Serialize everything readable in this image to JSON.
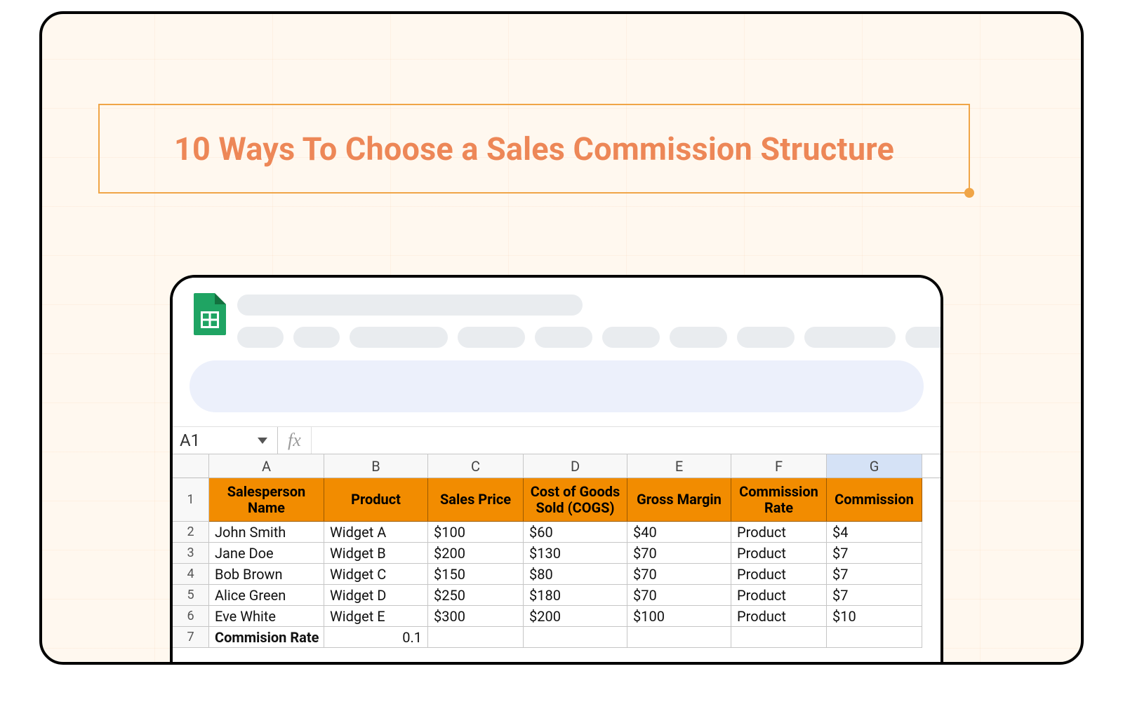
{
  "title": "10 Ways To Choose a Sales Commission Structure",
  "sheet": {
    "name_box": "A1",
    "fx_label": "fx",
    "columns": [
      "A",
      "B",
      "C",
      "D",
      "E",
      "F",
      "G"
    ],
    "selected_col": "G",
    "header_row_num": "1",
    "headers": {
      "A": "Salesperson Name",
      "B": "Product",
      "C": "Sales Price",
      "D": "Cost of Goods Sold (COGS)",
      "E": "Gross Margin",
      "F": "Commission Rate",
      "G": "Commission"
    },
    "rows": [
      {
        "num": "2",
        "A": "John Smith",
        "B": "Widget A",
        "C": "$100",
        "D": "$60",
        "E": "$40",
        "F": "Product",
        "G": "$4"
      },
      {
        "num": "3",
        "A": "Jane Doe",
        "B": "Widget B",
        "C": "$200",
        "D": "$130",
        "E": "$70",
        "F": "Product",
        "G": "$7"
      },
      {
        "num": "4",
        "A": "Bob Brown",
        "B": "Widget C",
        "C": "$150",
        "D": "$80",
        "E": "$70",
        "F": "Product",
        "G": "$7"
      },
      {
        "num": "5",
        "A": "Alice Green",
        "B": "Widget D",
        "C": "$250",
        "D": "$180",
        "E": "$70",
        "F": "Product",
        "G": "$7"
      },
      {
        "num": "6",
        "A": "Eve White",
        "B": "Widget E",
        "C": "$300",
        "D": "$200",
        "E": "$100",
        "F": "Product",
        "G": "$10"
      }
    ],
    "footer": {
      "num": "7",
      "A": "Commision Rate",
      "B": "0.1",
      "C": "",
      "D": "",
      "E": "",
      "F": "",
      "G": ""
    }
  },
  "skeleton_pill_widths": [
    66,
    66,
    140,
    96,
    82,
    82,
    82,
    82,
    130,
    70
  ]
}
